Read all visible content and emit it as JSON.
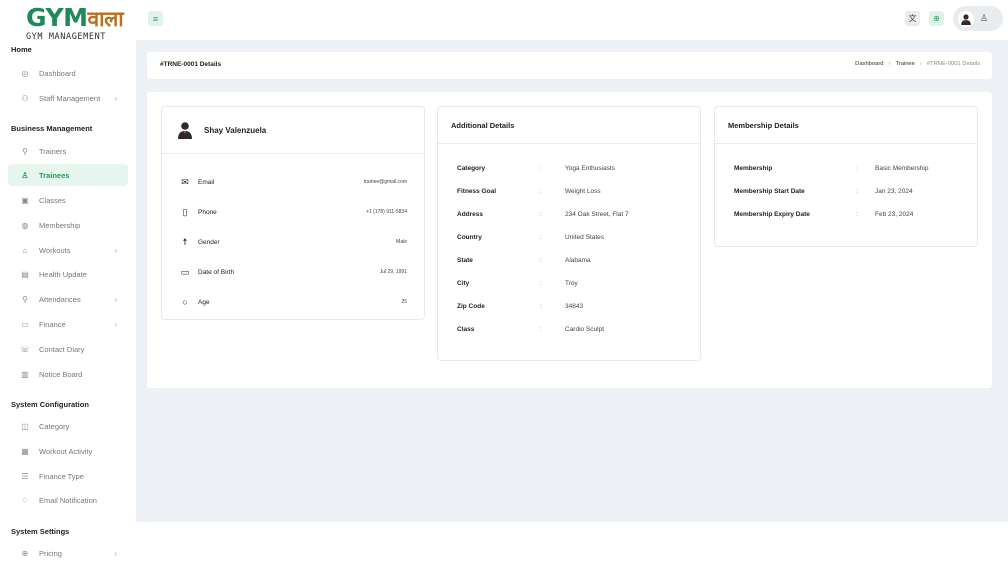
{
  "logo": {
    "main": "GYM",
    "accent": "वाला",
    "sub": "GYM MANAGEMENT"
  },
  "sidebar": {
    "sections": [
      {
        "title": "Home",
        "items": [
          {
            "label": "Dashboard",
            "icon": "dashboard-icon"
          },
          {
            "label": "Staff Management",
            "icon": "staff-icon",
            "has_children": true
          }
        ]
      },
      {
        "title": "Business Management",
        "items": [
          {
            "label": "Trainers",
            "icon": "trainer-icon"
          },
          {
            "label": "Trainees",
            "icon": "trainee-icon",
            "active": true
          },
          {
            "label": "Classes",
            "icon": "classes-icon"
          },
          {
            "label": "Membership",
            "icon": "membership-icon"
          },
          {
            "label": "Workouts",
            "icon": "workouts-icon",
            "has_children": true
          },
          {
            "label": "Health Update",
            "icon": "health-icon"
          },
          {
            "label": "Attendances",
            "icon": "attendance-icon",
            "has_children": true
          },
          {
            "label": "Finance",
            "icon": "finance-icon",
            "has_children": true
          },
          {
            "label": "Contact Diary",
            "icon": "contact-icon"
          },
          {
            "label": "Notice Board",
            "icon": "notice-icon"
          }
        ]
      },
      {
        "title": "System Configuration",
        "items": [
          {
            "label": "Category",
            "icon": "category-icon"
          },
          {
            "label": "Workout Activity",
            "icon": "activity-icon"
          },
          {
            "label": "Finance Type",
            "icon": "finance-type-icon"
          },
          {
            "label": "Email Notification",
            "icon": "notification-icon"
          }
        ]
      },
      {
        "title": "System Settings",
        "items": [
          {
            "label": "Pricing",
            "icon": "pricing-icon",
            "has_children": true
          }
        ]
      }
    ]
  },
  "topbar": {
    "menu_icon": "menu-icon",
    "lang_icon": "translate-icon",
    "globe_icon": "globe-icon",
    "user_icon": "user-icon"
  },
  "page": {
    "title": "#TRNE-0001 Details",
    "breadcrumb": [
      "Dashboard",
      "Trainee",
      "#TRNE-0001 Details"
    ]
  },
  "profile": {
    "name": "Shay Valenzuela",
    "rows": [
      {
        "label": "Email",
        "value": "trainee@gmail.com",
        "icon": "email-icon"
      },
      {
        "label": "Phone",
        "value": "+1 (178) 911-5834",
        "icon": "phone-icon"
      },
      {
        "label": "Gender",
        "value": "Male",
        "icon": "gender-icon"
      },
      {
        "label": "Date of Birth",
        "value": "Jul 29, 1991",
        "icon": "calendar-icon"
      },
      {
        "label": "Age",
        "value": "25",
        "icon": "age-icon"
      }
    ]
  },
  "additional": {
    "title": "Additional Details",
    "rows": [
      {
        "label": "Category",
        "value": "Yoga Enthusiasts"
      },
      {
        "label": "Fitness Goal",
        "value": "Weight Loss"
      },
      {
        "label": "Address",
        "value": "234 Oak Street, Flat 7"
      },
      {
        "label": "Country",
        "value": "United States"
      },
      {
        "label": "State",
        "value": "Alabama"
      },
      {
        "label": "City",
        "value": "Troy"
      },
      {
        "label": "Zip Code",
        "value": "34843"
      },
      {
        "label": "Class",
        "value": "Cardio Sculpt"
      }
    ]
  },
  "membership": {
    "title": "Membership Details",
    "rows": [
      {
        "label": "Membership",
        "value": "Basic Membership"
      },
      {
        "label": "Membership Start Date",
        "value": "Jan 23, 2024"
      },
      {
        "label": "Membership Expiry Date",
        "value": "Feb 23, 2024"
      }
    ]
  },
  "separator": ":",
  "colors": {
    "accent": "#1f9b5f",
    "accent_bg": "#e6f6ee",
    "logo_brown": "#b8721d",
    "page_bg": "#edf0f4"
  }
}
